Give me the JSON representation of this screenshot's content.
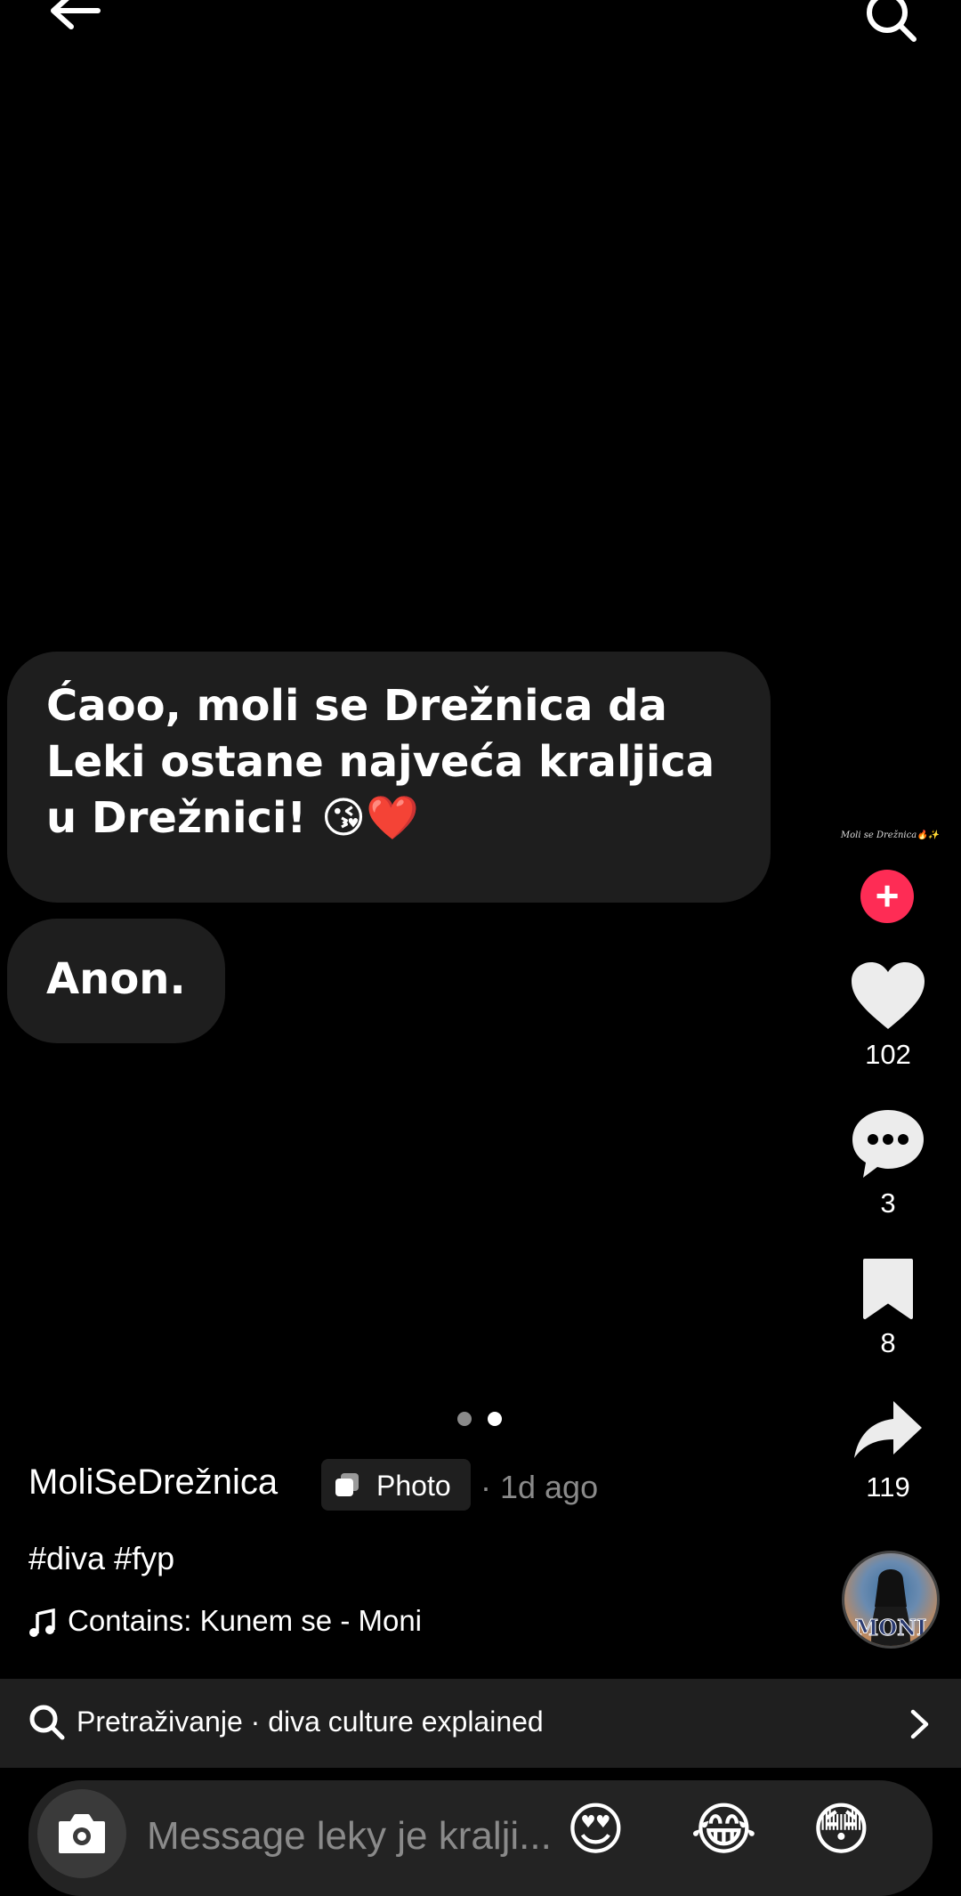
{
  "post": {
    "message": "Ćaoo, moli se Drežnica da Leki ostane najveća kraljica u Drežnici! 😘❤️",
    "signature": "Anon.",
    "author": "MoliSeDrežnica",
    "type_label": "Photo",
    "age": "· 1d ago",
    "hashtags": "#diva #fyp",
    "music": "Contains: Kunem se - Moni",
    "watermark": "Moli se Drežnica🔥✨",
    "carousel": {
      "count": 2,
      "active_index": 1
    }
  },
  "actions": {
    "likes": "102",
    "comments": "3",
    "saves": "8",
    "shares": "119",
    "follow_symbol": "+"
  },
  "avatar_text": "MONI",
  "search_suggestion": "Pretraživanje · diva culture explained",
  "composer": {
    "placeholder": "Message leky je kralji...",
    "emojis": [
      "😍",
      "😂",
      "😳"
    ]
  },
  "colors": {
    "background": "#000000",
    "bubble": "#1e1e1e",
    "follow": "#fe2c55",
    "muted": "#8a8a8a"
  }
}
